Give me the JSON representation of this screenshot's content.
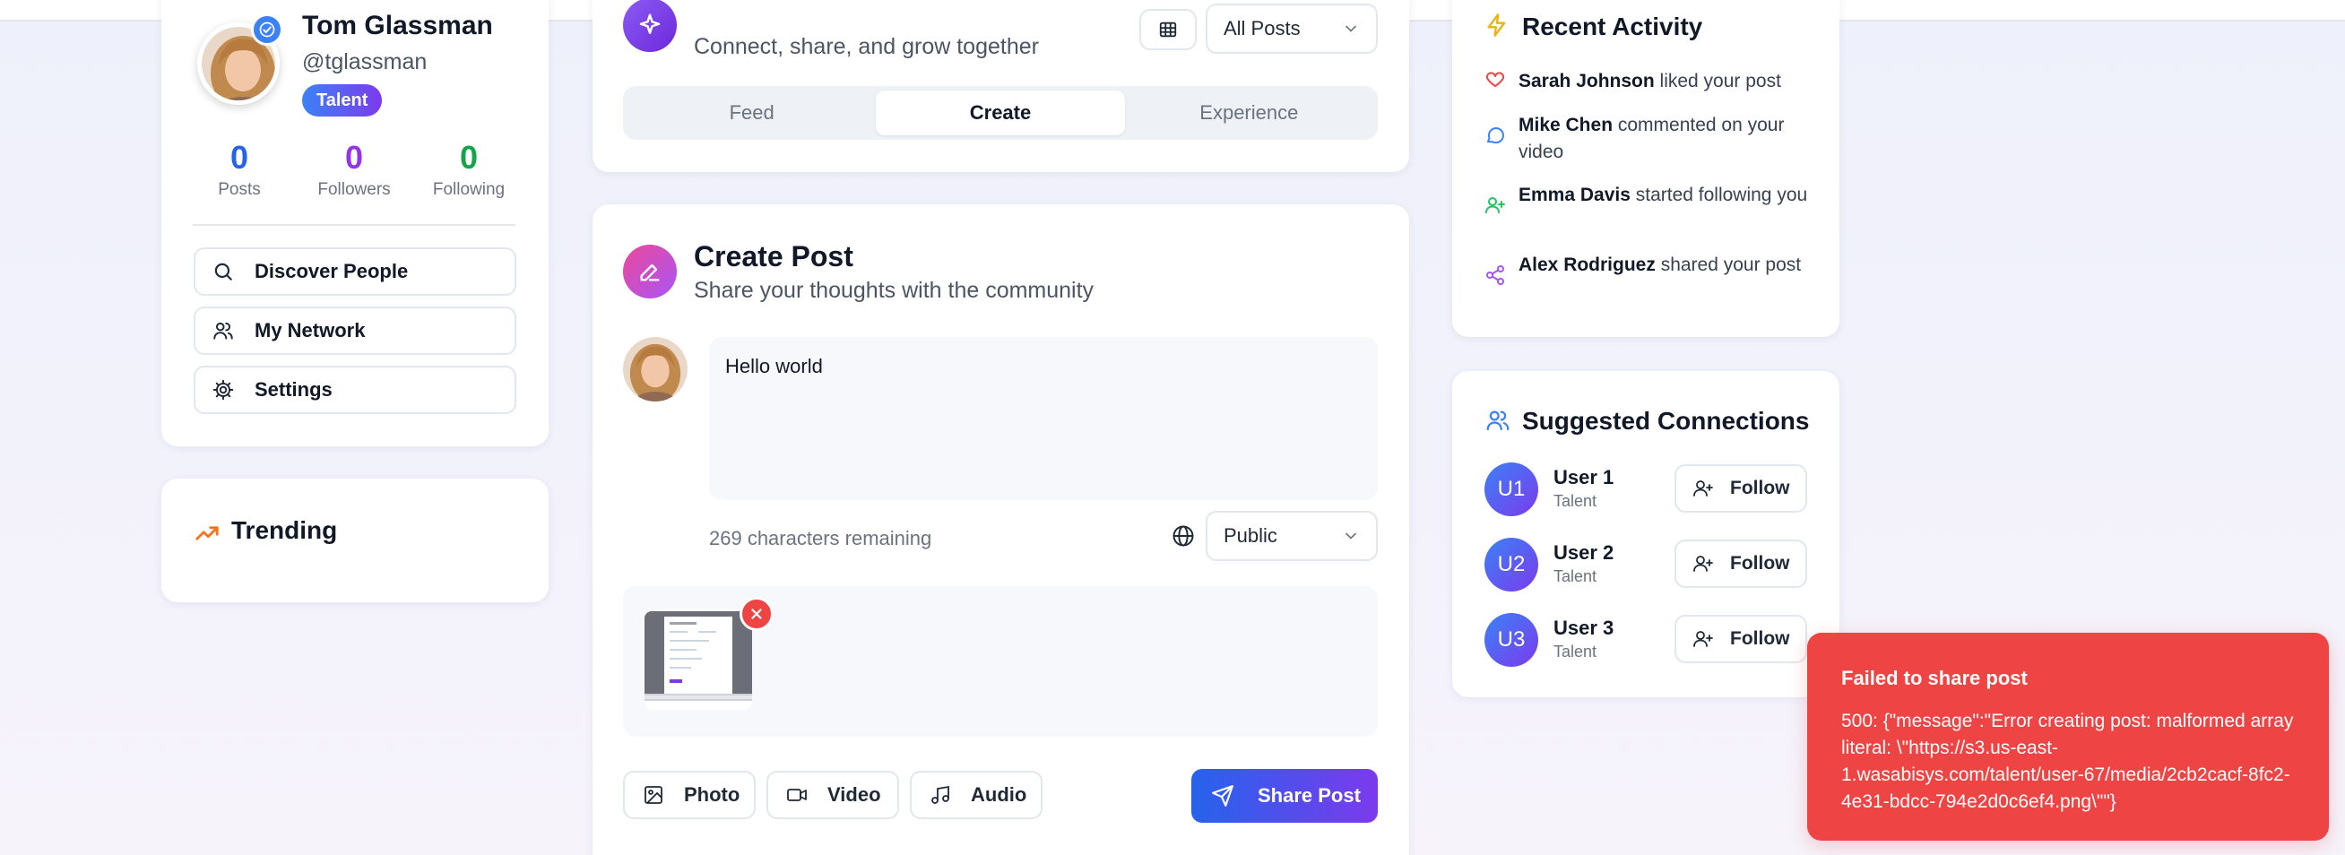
{
  "profile": {
    "name": "Tom Glassman",
    "handle": "@tglassman",
    "badge": "Talent",
    "stats": [
      {
        "value": "0",
        "label": "Posts",
        "color": "#2563eb"
      },
      {
        "value": "0",
        "label": "Followers",
        "color": "#9333ea"
      },
      {
        "value": "0",
        "label": "Following",
        "color": "#16a34a"
      }
    ],
    "nav": [
      {
        "label": "Discover People",
        "icon": "search-icon"
      },
      {
        "label": "My Network",
        "icon": "users-icon"
      },
      {
        "label": "Settings",
        "icon": "gear-icon"
      }
    ]
  },
  "trending": {
    "title": "Trending",
    "icon": "trending-up-icon"
  },
  "feed_header": {
    "tagline": "Connect, share, and grow together",
    "filter": "All Posts",
    "tabs": [
      {
        "label": "Feed",
        "active": false
      },
      {
        "label": "Create",
        "active": true
      },
      {
        "label": "Experience",
        "active": false
      }
    ]
  },
  "create_post": {
    "title": "Create Post",
    "subtitle": "Share your thoughts with the community",
    "content": "Hello world",
    "chars_remaining": "269 characters remaining",
    "visibility": "Public",
    "media_buttons": [
      {
        "label": "Photo",
        "icon": "image-icon"
      },
      {
        "label": "Video",
        "icon": "video-icon"
      },
      {
        "label": "Audio",
        "icon": "music-icon"
      }
    ],
    "share_label": "Share Post"
  },
  "recent_activity": {
    "title": "Recent Activity",
    "items": [
      {
        "who": "Sarah Johnson",
        "action": " liked your post",
        "icon": "heart-icon",
        "color": "#ef4444"
      },
      {
        "who": "Mike Chen",
        "action": " commented on your video",
        "icon": "comment-icon",
        "color": "#3b82f6"
      },
      {
        "who": "Emma Davis",
        "action": " started following you",
        "icon": "user-plus-icon",
        "color": "#22c55e"
      },
      {
        "who": "Alex Rodriguez",
        "action": " shared your post",
        "icon": "share-icon",
        "color": "#a855f7"
      }
    ]
  },
  "suggested": {
    "title": "Suggested Connections",
    "users": [
      {
        "initials": "U1",
        "name": "User 1",
        "role": "Talent",
        "follow": "Follow"
      },
      {
        "initials": "U2",
        "name": "User 2",
        "role": "Talent",
        "follow": "Follow"
      },
      {
        "initials": "U3",
        "name": "User 3",
        "role": "Talent",
        "follow": "Follow"
      }
    ]
  },
  "toast": {
    "title": "Failed to share post",
    "message": "500: {\"message\":\"Error creating post: malformed array literal: \\\"https://s3.us-east-1.wasabisys.com/talent/user-67/media/2cb2cacf-8fc2-4e31-bdcc-794e2d0c6ef4.png\\\"\"}"
  }
}
